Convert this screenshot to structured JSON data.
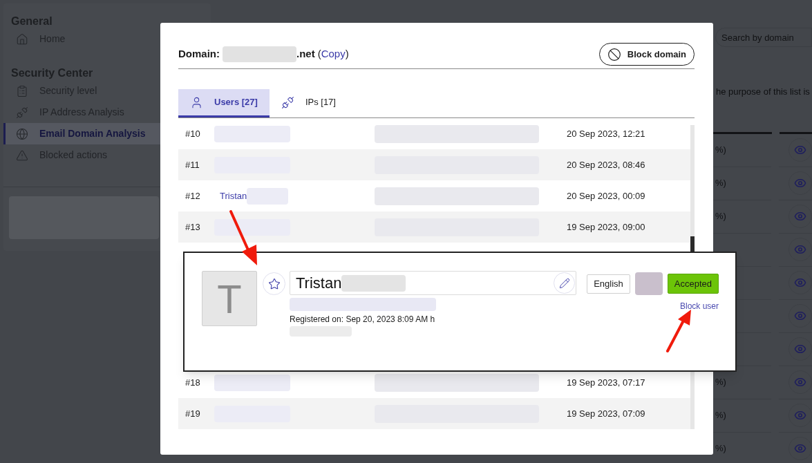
{
  "sidebar": {
    "sections": [
      {
        "title": "General",
        "items": [
          {
            "label": "Home",
            "kind": "home",
            "selected": false
          }
        ]
      },
      {
        "title": "Security Center",
        "items": [
          {
            "label": "Security level",
            "kind": "clipboard",
            "selected": false
          },
          {
            "label": "IP Address Analysis",
            "kind": "plug",
            "selected": false
          },
          {
            "label": "Email Domain Analysis",
            "kind": "globe",
            "selected": true
          },
          {
            "label": "Blocked actions",
            "kind": "warning",
            "selected": false
          }
        ]
      }
    ]
  },
  "background": {
    "search": {
      "placeholder": "Search by domain"
    },
    "intro": "he purpose of this list is",
    "rows": [
      {
        "share": "%)"
      },
      {
        "share": "%)"
      },
      {
        "share": "%)"
      },
      {},
      {},
      {},
      {},
      {
        "share": "%)"
      },
      {
        "share": "%)"
      },
      {
        "share": "%)"
      }
    ]
  },
  "modal": {
    "domain_label": "Domain:",
    "domain_suffix": ".net",
    "copy_open": "(",
    "copy_link": "Copy",
    "copy_close": ")",
    "block_button": "Block domain",
    "tabs": [
      {
        "label": "Users [27]",
        "kind": "user",
        "selected": true
      },
      {
        "label": "IPs [17]",
        "kind": "plug",
        "selected": false
      }
    ],
    "rows": [
      {
        "number": "#10",
        "date": "20 Sep 2023, 12:21"
      },
      {
        "number": "#11",
        "date": "20 Sep 2023, 08:46"
      },
      {
        "number": "#12",
        "name": "Tristan",
        "date": "20 Sep 2023, 00:09"
      },
      {
        "number": "#13",
        "date": "19 Sep 2023, 09:00"
      },
      {},
      {},
      {},
      {},
      {
        "number": "#18",
        "date": "19 Sep 2023, 07:17"
      },
      {
        "number": "#19",
        "date": "19 Sep 2023, 07:09"
      }
    ]
  },
  "popup": {
    "avatar_letter": "T",
    "name": "Tristan",
    "language": "English",
    "status": "Accepted",
    "block_link": "Block user",
    "registered": "Registered on: Sep 20, 2023 8:09 AM h"
  }
}
